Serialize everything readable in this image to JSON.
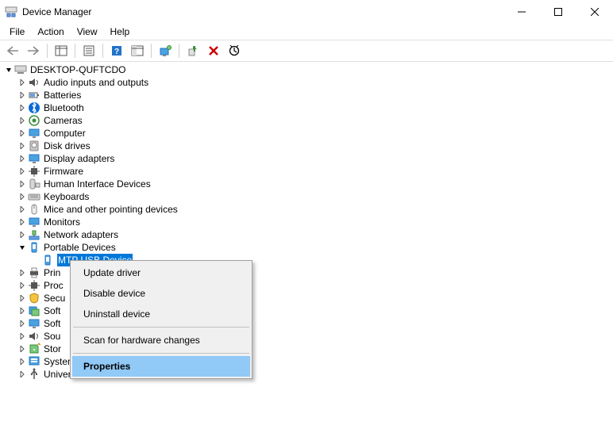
{
  "window": {
    "title": "Device Manager"
  },
  "menu": {
    "file": "File",
    "action": "Action",
    "view": "View",
    "help": "Help"
  },
  "root": {
    "name": "DESKTOP-QUFTCDO"
  },
  "categories": [
    {
      "label": "Audio inputs and outputs",
      "icon": "speaker"
    },
    {
      "label": "Batteries",
      "icon": "battery"
    },
    {
      "label": "Bluetooth",
      "icon": "bluetooth"
    },
    {
      "label": "Cameras",
      "icon": "camera"
    },
    {
      "label": "Computer",
      "icon": "monitor"
    },
    {
      "label": "Disk drives",
      "icon": "disk"
    },
    {
      "label": "Display adapters",
      "icon": "monitor"
    },
    {
      "label": "Firmware",
      "icon": "chip"
    },
    {
      "label": "Human Interface Devices",
      "icon": "hid"
    },
    {
      "label": "Keyboards",
      "icon": "keyboard"
    },
    {
      "label": "Mice and other pointing devices",
      "icon": "mouse"
    },
    {
      "label": "Monitors",
      "icon": "monitor"
    },
    {
      "label": "Network adapters",
      "icon": "network"
    }
  ],
  "expanded": {
    "label": "Portable Devices",
    "child": "MTP USB Device"
  },
  "post_categories": [
    {
      "label": "Prin",
      "full": "Printers",
      "icon": "printer"
    },
    {
      "label": "Proc",
      "full": "Processors",
      "icon": "chip"
    },
    {
      "label": "Secu",
      "full": "Security devices",
      "icon": "security"
    },
    {
      "label": "Soft",
      "full": "Software components",
      "icon": "software"
    },
    {
      "label": "Soft",
      "full": "Software devices",
      "icon": "monitor"
    },
    {
      "label": "Sou",
      "full": "Sound controllers",
      "icon": "speaker"
    },
    {
      "label": "Stor",
      "full": "Storage controllers",
      "icon": "storage"
    }
  ],
  "tail_categories": [
    {
      "label": "System devices",
      "icon": "system"
    },
    {
      "label": "Universal Serial Bus controllers",
      "icon": "usb"
    }
  ],
  "context_menu": {
    "update": "Update driver",
    "disable": "Disable device",
    "uninstall": "Uninstall device",
    "scan": "Scan for hardware changes",
    "properties": "Properties"
  }
}
